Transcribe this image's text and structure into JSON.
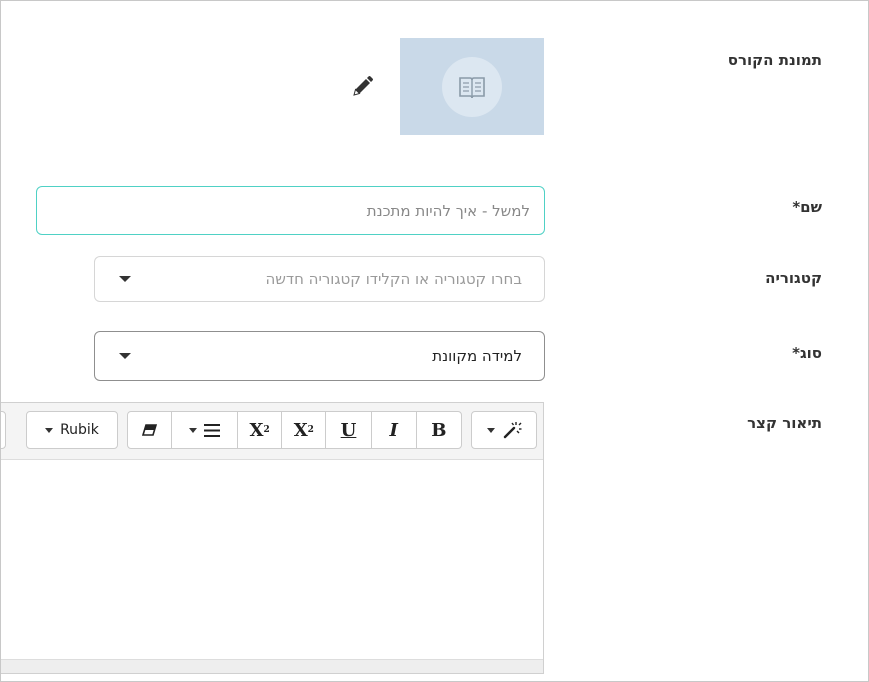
{
  "form": {
    "image_label": "תמונת הקורס",
    "name_label": "שם*",
    "name_placeholder": "למשל - איך להיות מתכנת",
    "category_label": "קטגוריה",
    "category_placeholder": "בחרו קטגוריה או הקלידו קטגוריה חדשה",
    "type_label": "סוג*",
    "type_value": "למידה מקוונת",
    "description_label": "תיאור קצר"
  },
  "toolbar": {
    "font_name": "Rubik",
    "bold_label": "B",
    "italic_label": "I",
    "underline_label": "U",
    "superscript_base": "X",
    "superscript_mark": "2",
    "subscript_base": "X",
    "subscript_mark": "2"
  },
  "icons": {
    "thumbnail": "book-icon",
    "edit": "pencil-icon",
    "magic": "magic-wand-icon",
    "eraser": "eraser-icon",
    "align": "align-icon"
  },
  "colors": {
    "focus_border": "#4fd1c5",
    "thumbnail_bg": "#c9d9e8"
  }
}
